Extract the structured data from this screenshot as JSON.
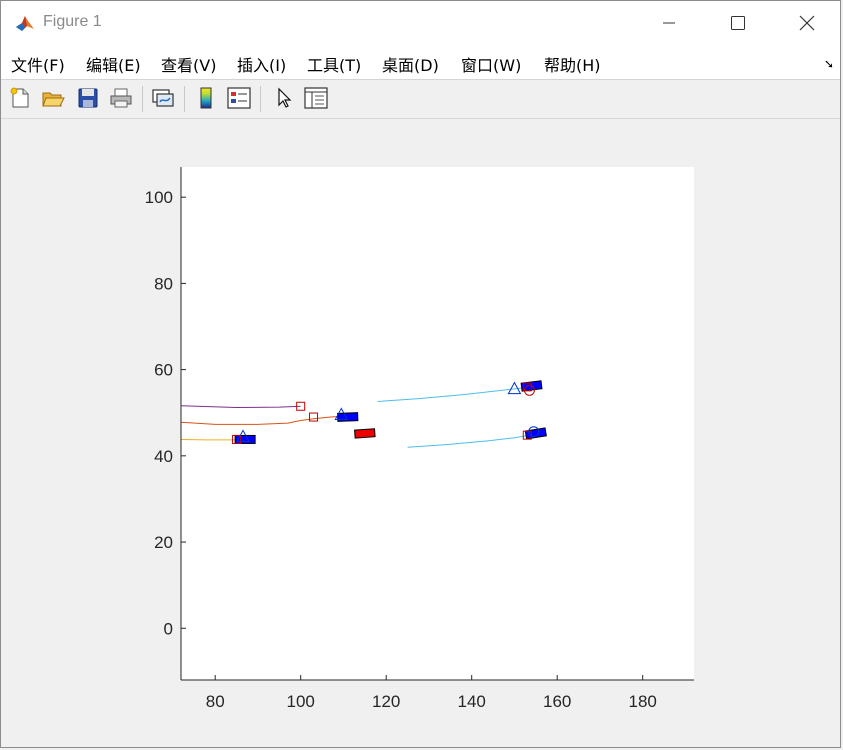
{
  "window": {
    "title": "Figure 1",
    "controls": {
      "minimize": "minimize",
      "maximize": "maximize",
      "close": "close"
    }
  },
  "menu": {
    "items": [
      "文件(F)",
      "编辑(E)",
      "查看(V)",
      "插入(I)",
      "工具(T)",
      "桌面(D)",
      "窗口(W)",
      "帮助(H)"
    ]
  },
  "toolbar": {
    "tools": [
      "new-figure-icon",
      "open-file-icon",
      "save-icon",
      "print-icon",
      "link-plot-icon",
      "colorbar-icon",
      "legend-icon",
      "pointer-icon",
      "property-inspector-icon"
    ]
  },
  "chart_data": {
    "type": "line",
    "title": "",
    "xlabel": "",
    "ylabel": "",
    "xlim": [
      72,
      192
    ],
    "ylim": [
      -12,
      107
    ],
    "xticks": [
      80,
      100,
      120,
      140,
      160,
      180
    ],
    "yticks": [
      0,
      20,
      40,
      60,
      80,
      100
    ],
    "grid": false,
    "series": [
      {
        "color": "#7e2f8e",
        "x": [
          72,
          85,
          95,
          100
        ],
        "y": [
          51.6,
          51.2,
          51.3,
          51.5
        ]
      },
      {
        "color": "#d95319",
        "x": [
          72,
          80,
          90,
          97,
          100,
          103,
          107,
          110
        ],
        "y": [
          47.8,
          47.3,
          47.3,
          47.6,
          48.2,
          48.6,
          49.0,
          49.2
        ]
      },
      {
        "color": "#edb120",
        "x": [
          72,
          78,
          85
        ],
        "y": [
          43.8,
          43.7,
          43.7
        ]
      },
      {
        "color": "#4dbeee",
        "x": [
          118,
          128,
          138,
          148,
          154
        ],
        "y": [
          52.6,
          53.3,
          54.2,
          55.3,
          56.0
        ]
      },
      {
        "color": "#4dbeee",
        "x": [
          125,
          134,
          144,
          150,
          155
        ],
        "y": [
          42.0,
          42.6,
          43.5,
          44.2,
          45.0
        ]
      }
    ],
    "markers": [
      {
        "shape": "square",
        "color": "#c00000",
        "x": 100,
        "y": 51.5
      },
      {
        "shape": "square",
        "color": "#c00000",
        "x": 103,
        "y": 49.0
      },
      {
        "shape": "square",
        "color": "#c00000",
        "x": 85,
        "y": 43.8
      },
      {
        "shape": "square",
        "color": "#c00000",
        "x": 153,
        "y": 44.8
      },
      {
        "shape": "square",
        "color": "#c00000",
        "x": 153,
        "y": 56.0
      },
      {
        "shape": "triangle",
        "color": "#0033cc",
        "x": 109.5,
        "y": 49.6
      },
      {
        "shape": "triangle",
        "color": "#0033cc",
        "x": 86.5,
        "y": 44.5
      },
      {
        "shape": "triangle",
        "color": "#0033cc",
        "x": 150,
        "y": 55.6
      },
      {
        "shape": "circle",
        "color": "#c00000",
        "x": 153.5,
        "y": 55.2
      },
      {
        "shape": "circle",
        "color": "#0033cc",
        "x": 154.5,
        "y": 45.6
      }
    ],
    "vehicles": [
      {
        "color": "#0000ff",
        "x": 111,
        "y": 49.0,
        "angle": 2
      },
      {
        "color": "#0000ff",
        "x": 87,
        "y": 43.8,
        "angle": 0
      },
      {
        "color": "#0000ff",
        "x": 155,
        "y": 45.2,
        "angle": 9
      },
      {
        "color": "#0000ff",
        "x": 154,
        "y": 56.2,
        "angle": 7
      },
      {
        "color": "#ee0000",
        "x": 115,
        "y": 45.2,
        "angle": 4
      }
    ]
  }
}
